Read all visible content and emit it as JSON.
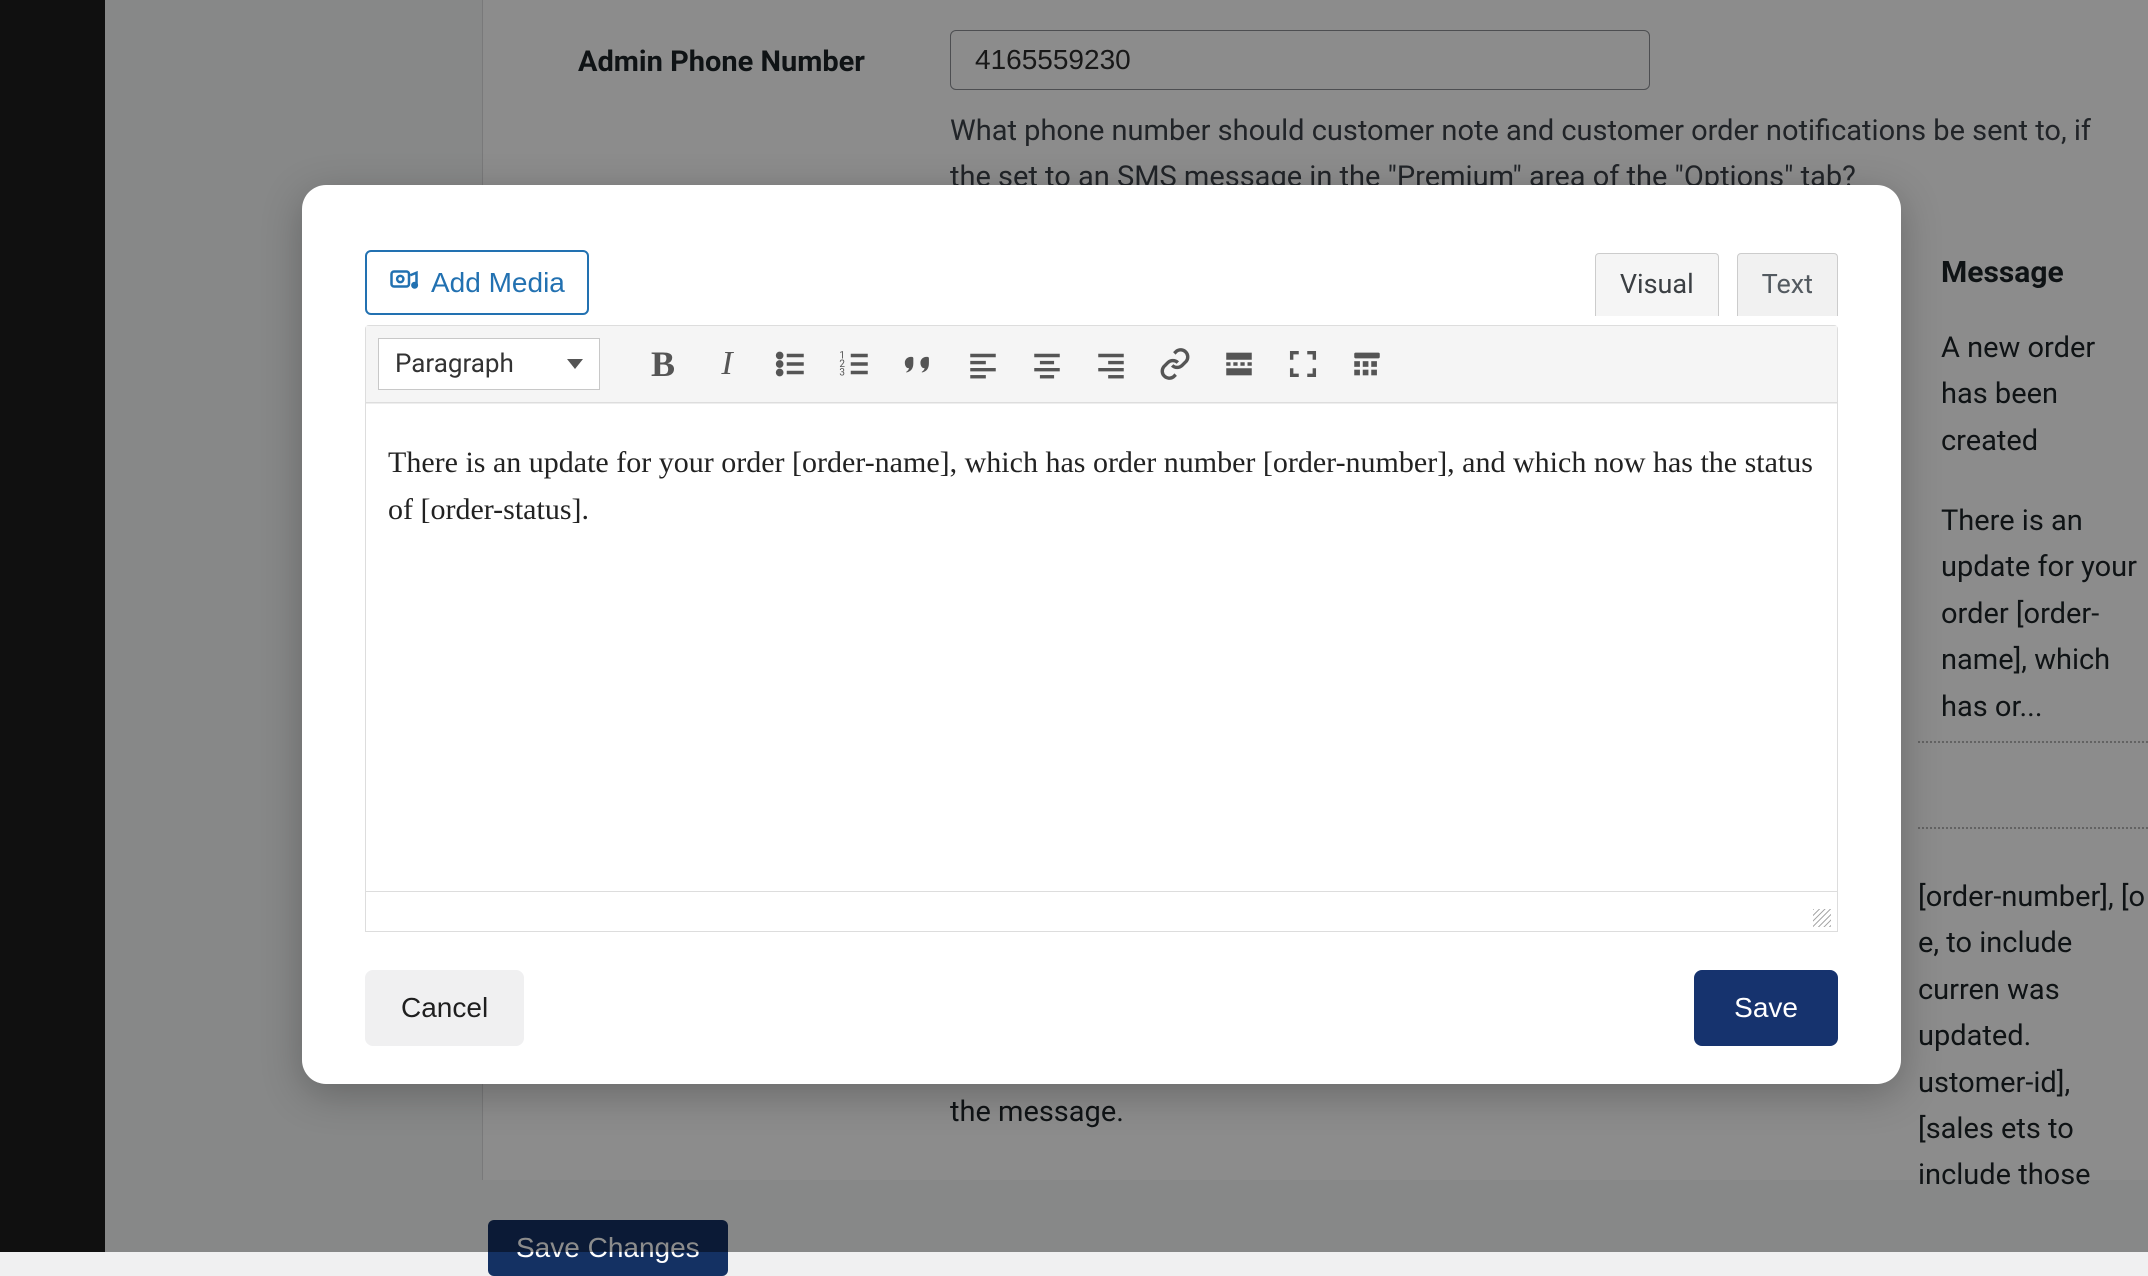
{
  "field": {
    "label": "Admin Phone Number",
    "value": "4165559230",
    "help": "What phone number should customer note and customer order notifications be sent to, if the set to an SMS message in the \"Premium\" area of the \"Options\" tab?"
  },
  "messages": {
    "heading": "Message",
    "row1": "A new order has been created",
    "row2": "There is an update for your order [order-name], which has or..."
  },
  "partialHelp": " [order-number], [o e, to include curren  was updated. ustomer-id], [sales ets to include those",
  "bottomHelp": "the message.",
  "saveChanges": "Save Changes",
  "modal": {
    "addMedia": "Add Media",
    "tabs": {
      "visual": "Visual",
      "text": "Text",
      "active": "visual"
    },
    "formatLabel": "Paragraph",
    "content": "There is an update for your order [order-name], which has order number [order-number], and which now has the status of [order-status].",
    "cancel": "Cancel",
    "save": "Save",
    "toolbarIcons": {
      "bold": "bold-icon",
      "italic": "italic-icon",
      "ul": "unordered-list-icon",
      "ol": "ordered-list-icon",
      "quote": "blockquote-icon",
      "alignLeft": "align-left-icon",
      "alignCenter": "align-center-icon",
      "alignRight": "align-right-icon",
      "link": "link-icon",
      "more": "read-more-icon",
      "fullscreen": "fullscreen-icon",
      "kitchenSink": "toolbar-toggle-icon"
    }
  }
}
